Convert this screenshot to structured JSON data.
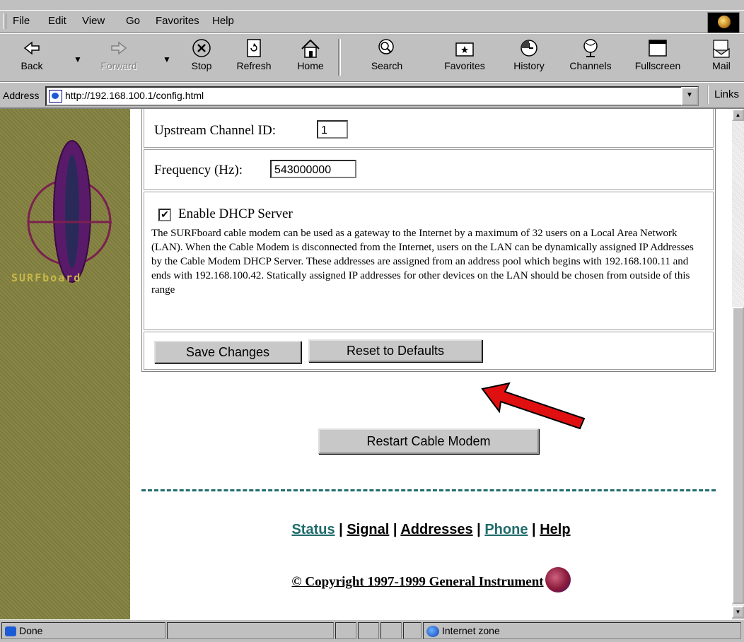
{
  "menu": {
    "items": [
      {
        "label": "File",
        "key": "F"
      },
      {
        "label": "Edit",
        "key": "E"
      },
      {
        "label": "View",
        "key": "V"
      },
      {
        "label": "Go",
        "key": "G"
      },
      {
        "label": "Favorites",
        "key": "a"
      },
      {
        "label": "Help",
        "key": "H"
      }
    ]
  },
  "toolbar": {
    "back": "Back",
    "forward": "Forward",
    "stop": "Stop",
    "refresh": "Refresh",
    "home": "Home",
    "search": "Search",
    "favorites": "Favorites",
    "history": "History",
    "channels": "Channels",
    "fullscreen": "Fullscreen",
    "mail": "Mail"
  },
  "address": {
    "label": "Address",
    "url": "http://192.168.100.1/config.html",
    "links": "Links"
  },
  "sidebar": {
    "logo_text": "SURFboard"
  },
  "form": {
    "upstream_label": "Upstream Channel ID:",
    "upstream_value": "1",
    "frequency_label": "Frequency (Hz):",
    "frequency_value": "543000000",
    "dhcp_label": "Enable DHCP Server",
    "dhcp_checked": true,
    "dhcp_description": "The SURFboard cable modem can be used as a gateway to the Internet by a maximum of 32 users on a Local Area Network (LAN). When the Cable Modem is disconnected from the Internet, users on the LAN can be dynamically assigned IP Addresses by the Cable Modem DHCP Server. These addresses are assigned from an address pool which begins with 192.168.100.11 and ends with 192.168.100.42. Statically assigned IP addresses for other devices on the LAN should be chosen from outside of this range",
    "save_button": "Save Changes",
    "reset_button": "Reset to Defaults",
    "restart_button": "Restart Cable Modem"
  },
  "nav": {
    "status": "Status",
    "signal": "Signal",
    "addresses": "Addresses",
    "phone": "Phone",
    "help": "Help",
    "separator": "|"
  },
  "footer": {
    "copyright": "© Copyright 1997-1999 General Instrument"
  },
  "statusbar": {
    "text": "Done",
    "zone": "Internet zone"
  },
  "colors": {
    "sidebar": "#7c7a3c",
    "teal_link": "#1f6b6b",
    "arrow": "#e01010"
  }
}
